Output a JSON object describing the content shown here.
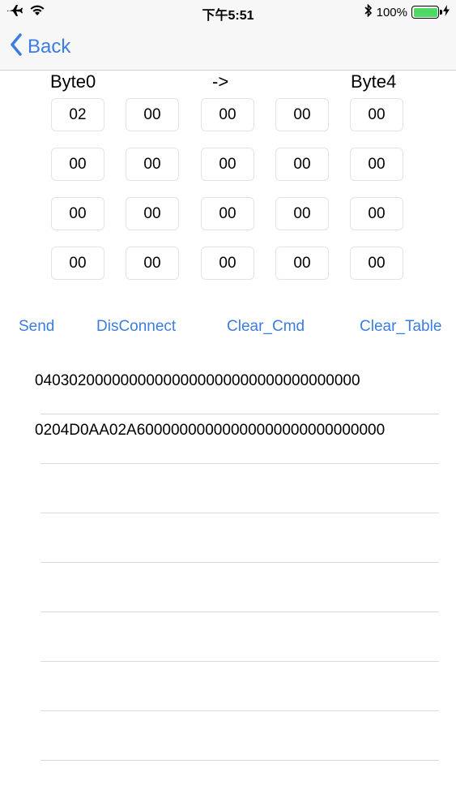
{
  "status_bar": {
    "time": "下午5:51",
    "battery_text": "100%",
    "icons": [
      "airplane-icon",
      "wifi-icon",
      "bluetooth-icon",
      "battery-icon",
      "charging-icon"
    ],
    "battery_level": 1.0,
    "battery_color": "#4cd964"
  },
  "nav": {
    "back_label": "Back",
    "accent_color": "#3b7de1"
  },
  "bytes": {
    "header_start": "Byte0",
    "header_arrow": "->",
    "header_end": "Byte4",
    "rows": [
      [
        "02",
        "00",
        "00",
        "00",
        "00"
      ],
      [
        "00",
        "00",
        "00",
        "00",
        "00"
      ],
      [
        "00",
        "00",
        "00",
        "00",
        "00"
      ],
      [
        "00",
        "00",
        "00",
        "00",
        "00"
      ]
    ]
  },
  "actions": {
    "send": "Send",
    "disconnect": "DisConnect",
    "clear_cmd": "Clear_Cmd",
    "clear_table": "Clear_Table"
  },
  "table": {
    "rows": [
      "04030200000000000000000000000000000000",
      "0204D0AA02A60000000000000000000000000000",
      "",
      "",
      "",
      "",
      "",
      ""
    ]
  }
}
